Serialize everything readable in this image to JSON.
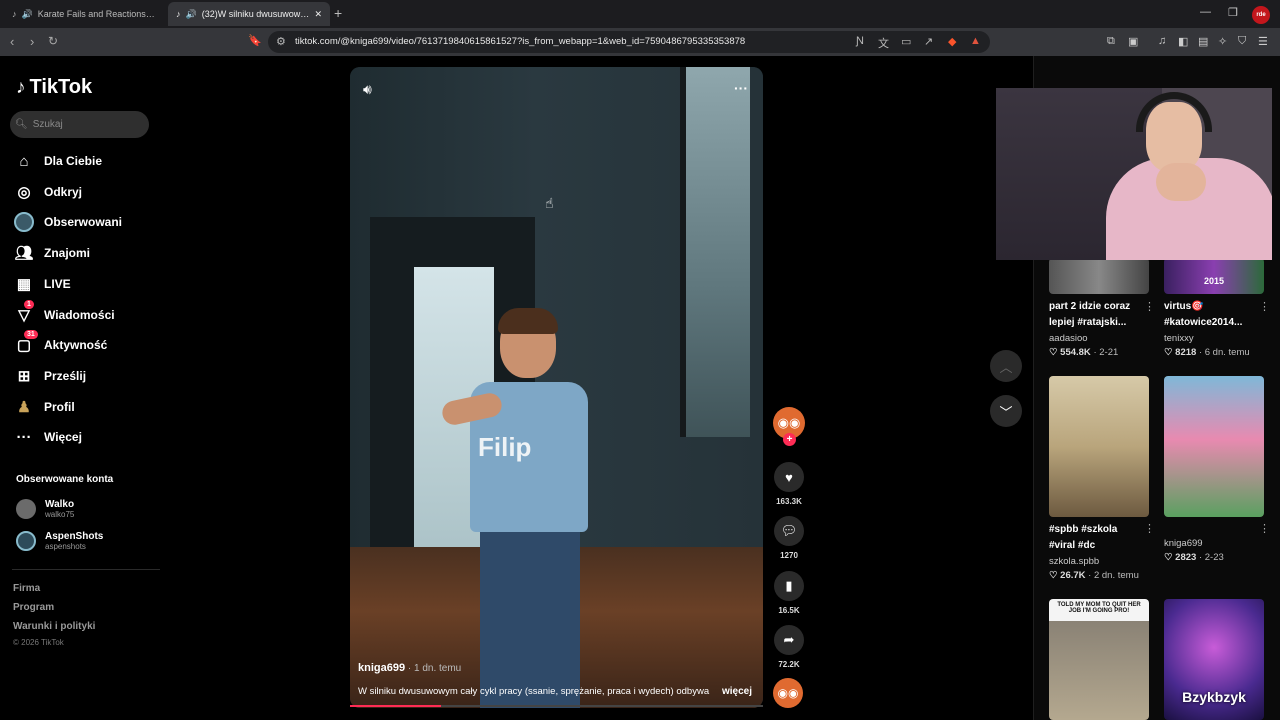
{
  "browser": {
    "tabs": [
      {
        "title": "Karate Fails and Reactions | TikTo",
        "active": false
      },
      {
        "title": "(32)W silniku dwusuwowym c",
        "active": true
      }
    ],
    "url": "tiktok.com/@kniga699/video/7613719840615861527?is_from_webapp=1&web_id=7590486795335353878",
    "profile_badge": "rde"
  },
  "sidebar": {
    "logo": "TikTok",
    "search_placeholder": "Szukaj",
    "nav": [
      {
        "label": "Dla Ciebie",
        "icon": "home-icon"
      },
      {
        "label": "Odkryj",
        "icon": "compass-icon"
      },
      {
        "label": "Obserwowani",
        "icon": "following-avatar-icon"
      },
      {
        "label": "Znajomi",
        "icon": "friends-icon"
      },
      {
        "label": "LIVE",
        "icon": "live-icon"
      },
      {
        "label": "Wiadomości",
        "icon": "messages-icon",
        "badge": "1"
      },
      {
        "label": "Aktywność",
        "icon": "activity-icon",
        "badge": "31"
      },
      {
        "label": "Prześlij",
        "icon": "upload-icon"
      },
      {
        "label": "Profil",
        "icon": "profile-icon"
      },
      {
        "label": "Więcej",
        "icon": "more-icon"
      }
    ],
    "followed_title": "Obserwowane konta",
    "followed": [
      {
        "name": "Walko",
        "handle": "walko75"
      },
      {
        "name": "AspenShots",
        "handle": "aspenshots"
      }
    ],
    "footer": [
      "Firma",
      "Program",
      "Warunki i polityki"
    ],
    "copyright": "© 2026 TikTok"
  },
  "video": {
    "author": "kniga699",
    "time": " · 1 dn. temu",
    "caption": "W silniku dwusuwowym cały cykl pracy (ssanie, sprężanie, praca i wydech) odbywa",
    "more": "więcej",
    "shirt_text": "Filip",
    "progress": 0.22
  },
  "actions": {
    "likes": "163.3K",
    "comments": "1270",
    "saves": "16.5K",
    "shares": "72.2K"
  },
  "recommended": [
    {
      "title1": "part 2 idzie coraz",
      "title2": "lepiej #ratajski...",
      "author": "aadasioo",
      "likes": "554.8K",
      "age": "2-21",
      "thumb_text": ""
    },
    {
      "title1": "virtus🎯",
      "title2": "#katowice2014...",
      "author": "tenixxy",
      "likes": "8218",
      "age": "6 dn. temu",
      "thumb_text": "2015"
    },
    {
      "title1": "#spbb #szkola",
      "title2": "#viral #dc",
      "author": "szkola.spbb",
      "likes": "26.7K",
      "age": "2 dn. temu",
      "thumb_text": ""
    },
    {
      "title1": "",
      "title2": "",
      "author": "kniga699",
      "likes": "2823",
      "age": "2-23",
      "thumb_text": ""
    },
    {
      "title1": "",
      "title2": "",
      "author": "",
      "likes": "",
      "age": "",
      "thumb_text": "TOLD MY MOM TO QUIT HER JOB I'M GOING PRO!"
    },
    {
      "title1": "",
      "title2": "",
      "author": "",
      "likes": "",
      "age": "",
      "thumb_text": "Bzykbzyk"
    }
  ]
}
